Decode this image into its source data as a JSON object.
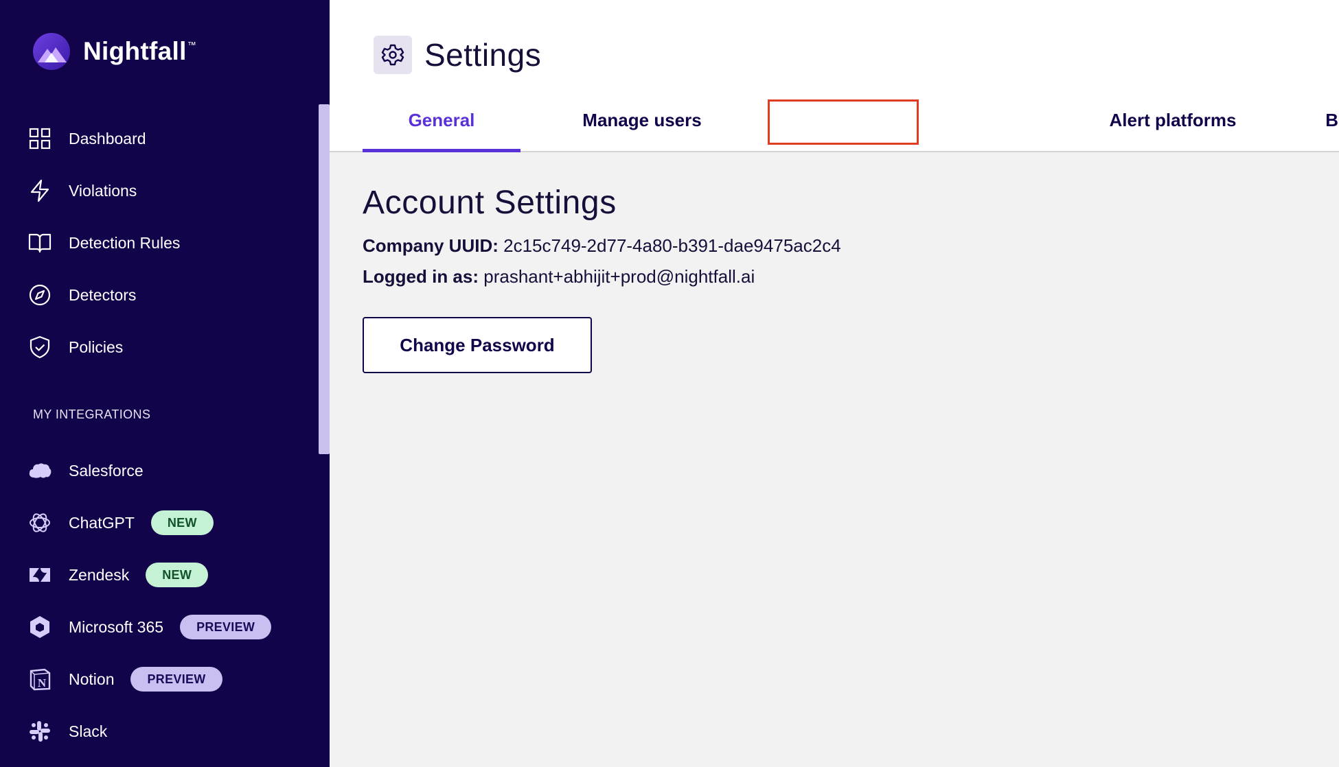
{
  "brand": {
    "name": "Nightfall",
    "trademark": "™"
  },
  "sidebar": {
    "nav": [
      {
        "label": "Dashboard",
        "icon": "dashboard-grid-icon"
      },
      {
        "label": "Violations",
        "icon": "lightning-icon"
      },
      {
        "label": "Detection Rules",
        "icon": "book-icon"
      },
      {
        "label": "Detectors",
        "icon": "compass-icon"
      },
      {
        "label": "Policies",
        "icon": "shield-check-icon"
      }
    ],
    "integrations_heading": "MY INTEGRATIONS",
    "integrations": [
      {
        "label": "Salesforce",
        "icon": "salesforce-cloud-icon",
        "badge": ""
      },
      {
        "label": "ChatGPT",
        "icon": "chatgpt-icon",
        "badge": "NEW"
      },
      {
        "label": "Zendesk",
        "icon": "zendesk-icon",
        "badge": "NEW"
      },
      {
        "label": "Microsoft 365",
        "icon": "microsoft-365-icon",
        "badge": "PREVIEW"
      },
      {
        "label": "Notion",
        "icon": "notion-icon",
        "badge": "PREVIEW"
      },
      {
        "label": "Slack",
        "icon": "slack-icon",
        "badge": ""
      }
    ]
  },
  "header": {
    "title": "Settings",
    "icon": "gear-icon",
    "tabs": [
      {
        "label": "General",
        "active": true
      },
      {
        "label": "Manage users",
        "active": false
      },
      {
        "label": "Alert platforms",
        "active": false,
        "highlighted": true
      },
      {
        "label": "Billing",
        "active": false
      }
    ]
  },
  "account": {
    "heading": "Account Settings",
    "company_uuid_label": "Company UUID:",
    "company_uuid": "2c15c749-2d77-4a80-b391-dae9475ac2c4",
    "logged_in_label": "Logged in as:",
    "logged_in_email": "prashant+abhijit+prod@nightfall.ai",
    "change_password_label": "Change Password"
  },
  "colors": {
    "sidebar_bg": "#13034a",
    "accent": "#5a31d6",
    "highlight": "#e03c1f",
    "badge_new": "#c5f2d4",
    "badge_preview": "#c9bff0"
  }
}
